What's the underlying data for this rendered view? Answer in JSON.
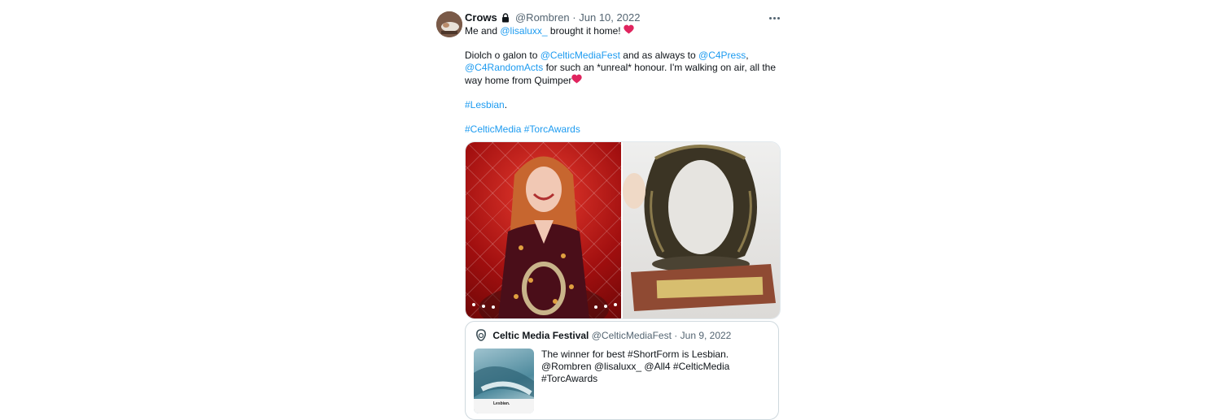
{
  "tweet": {
    "author_name": "Crows",
    "author_handle": "@Rombren",
    "date": "Jun 10, 2022",
    "line1_a": "Me and",
    "line1_mention": "@lisaluxx_",
    "line1_b": "brought it home!",
    "p2_a": "Diolch o galon to",
    "p2_mention1": "@CelticMediaFest",
    "p2_b": "and as always to",
    "p2_mention2": "@C4Press",
    "p2_c": ",",
    "p2_mention3": "@C4RandomActs",
    "p2_d": "for such an *unreal* honour. I'm walking on air, all the way home from Quimper",
    "hashtag_lesbian": "#Lesbian",
    "hashtag_lesbian_suffix": ".",
    "hashtag_celticmedia": "#CelticMedia",
    "hashtag_torcawards": "#TorcAwards"
  },
  "quoted": {
    "name": "Celtic Media Festival",
    "handle": "@CelticMediaFest",
    "date": "Jun 9, 2022",
    "text": "The winner for best #ShortForm is Lesbian. @Rombren @lisaluxx_ @All4 #CelticMedia #TorcAwards",
    "thumb_caption": "Lesbian."
  },
  "icons": {
    "lock": "lock-icon",
    "heart": "heart-emoji",
    "more": "more-options-icon",
    "torc_logo": "celtic-media-logo-icon"
  },
  "colors": {
    "link": "#1d9bf0",
    "muted": "#536471",
    "heart": "#e0245e"
  }
}
